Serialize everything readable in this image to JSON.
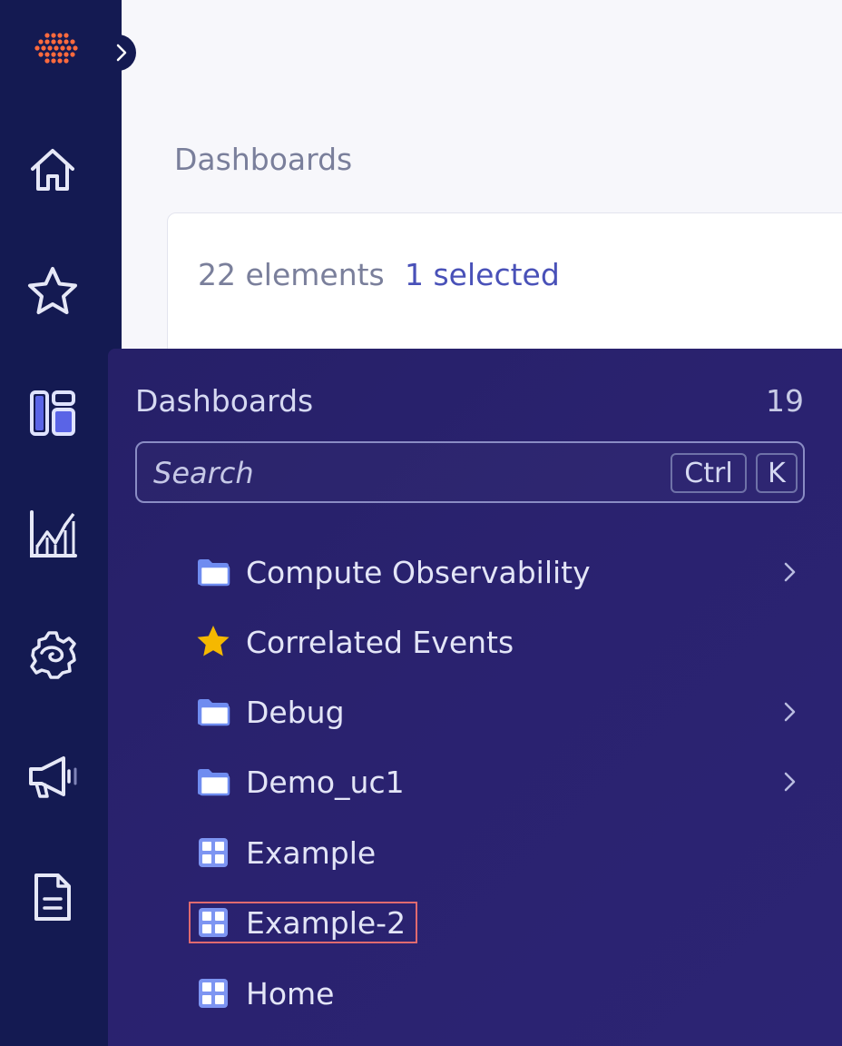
{
  "colors": {
    "rail_bg": "#141a52",
    "panel_bg": "#272069",
    "accent": "#4951b8",
    "logo": "#ff6a3d",
    "star": "#f5b800",
    "highlight": "#e06a6f"
  },
  "rail": {
    "logo_icon": "hexagon-dots-logo-icon",
    "expand_icon": "chevron-right-icon",
    "items": [
      {
        "icon": "home-icon"
      },
      {
        "icon": "star-icon"
      },
      {
        "icon": "dashboards-icon"
      },
      {
        "icon": "chart-icon"
      },
      {
        "icon": "gear-icon"
      },
      {
        "icon": "megaphone-icon"
      },
      {
        "icon": "document-icon"
      }
    ]
  },
  "main": {
    "heading": "Dashboards",
    "count_text": "22 elements",
    "selected_text": "1 selected"
  },
  "panel": {
    "title": "Dashboards",
    "count": "19",
    "search": {
      "placeholder": "Search",
      "shortcut_ctrl": "Ctrl",
      "shortcut_key": "K"
    },
    "items": [
      {
        "label": "Compute Observability",
        "icon": "folder-icon",
        "has_children": true
      },
      {
        "label": "Correlated Events",
        "icon": "star-icon",
        "has_children": false
      },
      {
        "label": "Debug",
        "icon": "folder-icon",
        "has_children": true
      },
      {
        "label": "Demo_uc1",
        "icon": "folder-icon",
        "has_children": true
      },
      {
        "label": "Example",
        "icon": "dashboard-grid-icon",
        "has_children": false
      },
      {
        "label": "Example-2",
        "icon": "dashboard-grid-icon",
        "has_children": false,
        "highlighted": true
      },
      {
        "label": "Home",
        "icon": "dashboard-grid-icon",
        "has_children": false
      }
    ]
  }
}
